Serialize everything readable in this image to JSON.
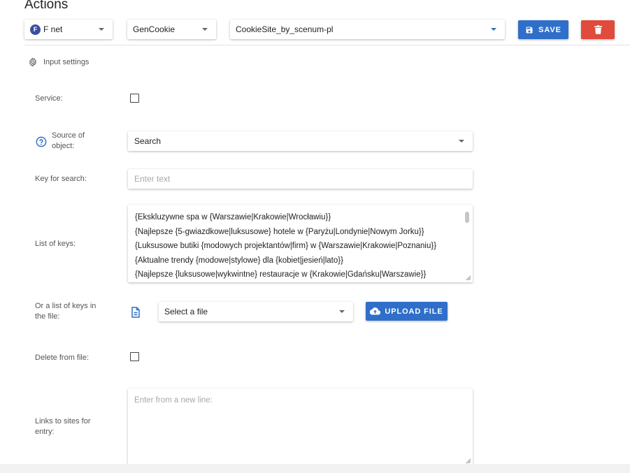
{
  "header": {
    "title": "Actions",
    "account_badge": "F",
    "account_select": "F net",
    "generator_select": "GenCookie",
    "site_select": "CookieSite_by_scenum-pl",
    "save_label": "SAVE"
  },
  "colors": {
    "primary": "#2f6fc9",
    "danger": "#e14b3b",
    "badge": "#3a4ea0"
  },
  "settings": {
    "section_title": "Input settings",
    "service_label": "Service:",
    "service_checked": false,
    "source_label_1": "Source of",
    "source_label_2": "object:",
    "source_value": "Search",
    "key_label": "Key for search:",
    "key_placeholder": "Enter text",
    "list_label": "List of keys:",
    "keys": [
      "{Ekskluzywne spa w {Warszawie|Krakowie|Wrocławiu}}",
      "{Najlepsze {5-gwiazdkowe|luksusowe} hotele w {Paryżu|Londynie|Nowym Jorku}}",
      "{Luksusowe butiki {modowych projektantów|firm} w {Warszawie|Krakowie|Poznaniu}}",
      "{Aktualne trendy {modowe|stylowe} dla {kobiet|jesień|lato}}",
      "{Najlepsze {luksusowe|wykwintne} restauracje w {Krakowie|Gdańsku|Warszawie}}"
    ],
    "file_label_1": "Or a list of keys in",
    "file_label_2": "the file:",
    "file_placeholder": "Select a file",
    "upload_label": "UPLOAD FILE",
    "delete_label": "Delete from file:",
    "delete_checked": false,
    "links_label_1": "Links to sites for",
    "links_label_2": "entry:",
    "links_placeholder": "Enter from a new line:"
  }
}
